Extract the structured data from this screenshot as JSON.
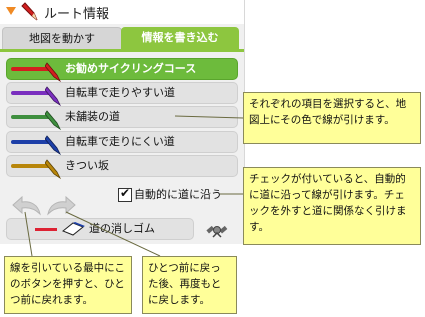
{
  "header": {
    "title": "ルート情報"
  },
  "tabs": [
    {
      "label": "地図を動かす",
      "active": false
    },
    {
      "label": "情報を書き込む",
      "active": true
    }
  ],
  "routes": [
    {
      "label": "お勧めサイクリングコース",
      "color": "#d21f1f",
      "selected": true
    },
    {
      "label": "自転車で走りやすい道",
      "color": "#7a2fbf",
      "selected": false
    },
    {
      "label": "未舗装の道",
      "color": "#3f8f3f",
      "selected": false
    },
    {
      "label": "自転車で走りにくい道",
      "color": "#1d3fa8",
      "selected": false
    },
    {
      "label": "きつい坂",
      "color": "#b8860b",
      "selected": false
    }
  ],
  "auto_snap": {
    "label": "自動的に道に沿う",
    "checked": true
  },
  "eraser": {
    "label": "道の消しゴム"
  },
  "icons": {
    "title": "pencil-icon",
    "undo": "undo-arrow-icon",
    "redo": "redo-arrow-icon",
    "satellite": "satellite-icon"
  },
  "notes": {
    "note1": "それぞれの項目を選択すると、地図上にその色で線が引けます。",
    "note2": "チェックが付いていると、自動的に道に沿って線が引けます。チェックを外すと道に関係なく引けます。",
    "note3": "線を引いている最中にこのボタンを押すと、ひとつ前に戻れます。",
    "note4": "ひとつ前に戻った後、再度もとに戻します。"
  },
  "colors": {
    "accent": "#8dc63f",
    "note_bg": "#ffff99"
  }
}
